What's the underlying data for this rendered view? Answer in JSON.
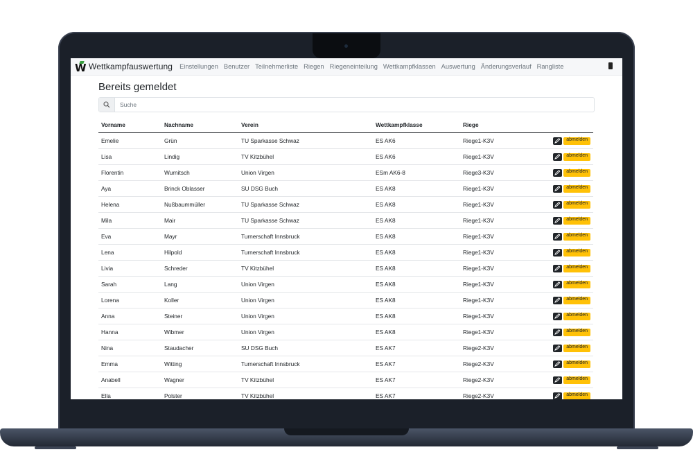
{
  "brand": "Wettkampfauswertung",
  "nav": [
    "Einstellungen",
    "Benutzer",
    "Teilnehmerliste",
    "Riegen",
    "Riegeneinteilung",
    "Wettkampfklassen",
    "Auswertung",
    "Änderungsverlauf",
    "Rangliste"
  ],
  "title": "Bereits gemeldet",
  "search": {
    "placeholder": "Suche"
  },
  "columns": [
    "Vorname",
    "Nachname",
    "Verein",
    "Wettkampfklasse",
    "Riege"
  ],
  "unregister_label": "abmelden",
  "rows": [
    [
      "Emelie",
      "Grün",
      "TU Sparkasse Schwaz",
      "ES AK6",
      "Riege1-K3V"
    ],
    [
      "Lisa",
      "Lindig",
      "TV Kitzbühel",
      "ES AK6",
      "Riege1-K3V"
    ],
    [
      "Florentin",
      "Wurnitsch",
      "Union Virgen",
      "ESm AK6-8",
      "Riege3-K3V"
    ],
    [
      "Aya",
      "Brinck Oblasser",
      "SU DSG Buch",
      "ES AK8",
      "Riege1-K3V"
    ],
    [
      "Helena",
      "Nußbaummüller",
      "TU Sparkasse Schwaz",
      "ES AK8",
      "Riege1-K3V"
    ],
    [
      "Mila",
      "Mair",
      "TU Sparkasse Schwaz",
      "ES AK8",
      "Riege1-K3V"
    ],
    [
      "Eva",
      "Mayr",
      "Turnerschaft Innsbruck",
      "ES AK8",
      "Riege1-K3V"
    ],
    [
      "Lena",
      "Hilpold",
      "Turnerschaft Innsbruck",
      "ES AK8",
      "Riege1-K3V"
    ],
    [
      "Livia",
      "Schreder",
      "TV Kitzbühel",
      "ES AK8",
      "Riege1-K3V"
    ],
    [
      "Sarah",
      "Lang",
      "Union Virgen",
      "ES AK8",
      "Riege1-K3V"
    ],
    [
      "Lorena",
      "Koller",
      "Union Virgen",
      "ES AK8",
      "Riege1-K3V"
    ],
    [
      "Anna",
      "Steiner",
      "Union Virgen",
      "ES AK8",
      "Riege1-K3V"
    ],
    [
      "Hanna",
      "Wibmer",
      "Union Virgen",
      "ES AK8",
      "Riege1-K3V"
    ],
    [
      "Nina",
      "Staudacher",
      "SU DSG Buch",
      "ES AK7",
      "Riege2-K3V"
    ],
    [
      "Emma",
      "Witting",
      "Turnerschaft Innsbruck",
      "ES AK7",
      "Riege2-K3V"
    ],
    [
      "Anabell",
      "Wagner",
      "TV Kitzbühel",
      "ES AK7",
      "Riege2-K3V"
    ],
    [
      "Ella",
      "Polster",
      "TV Kitzbühel",
      "ES AK7",
      "Riege2-K3V"
    ]
  ]
}
